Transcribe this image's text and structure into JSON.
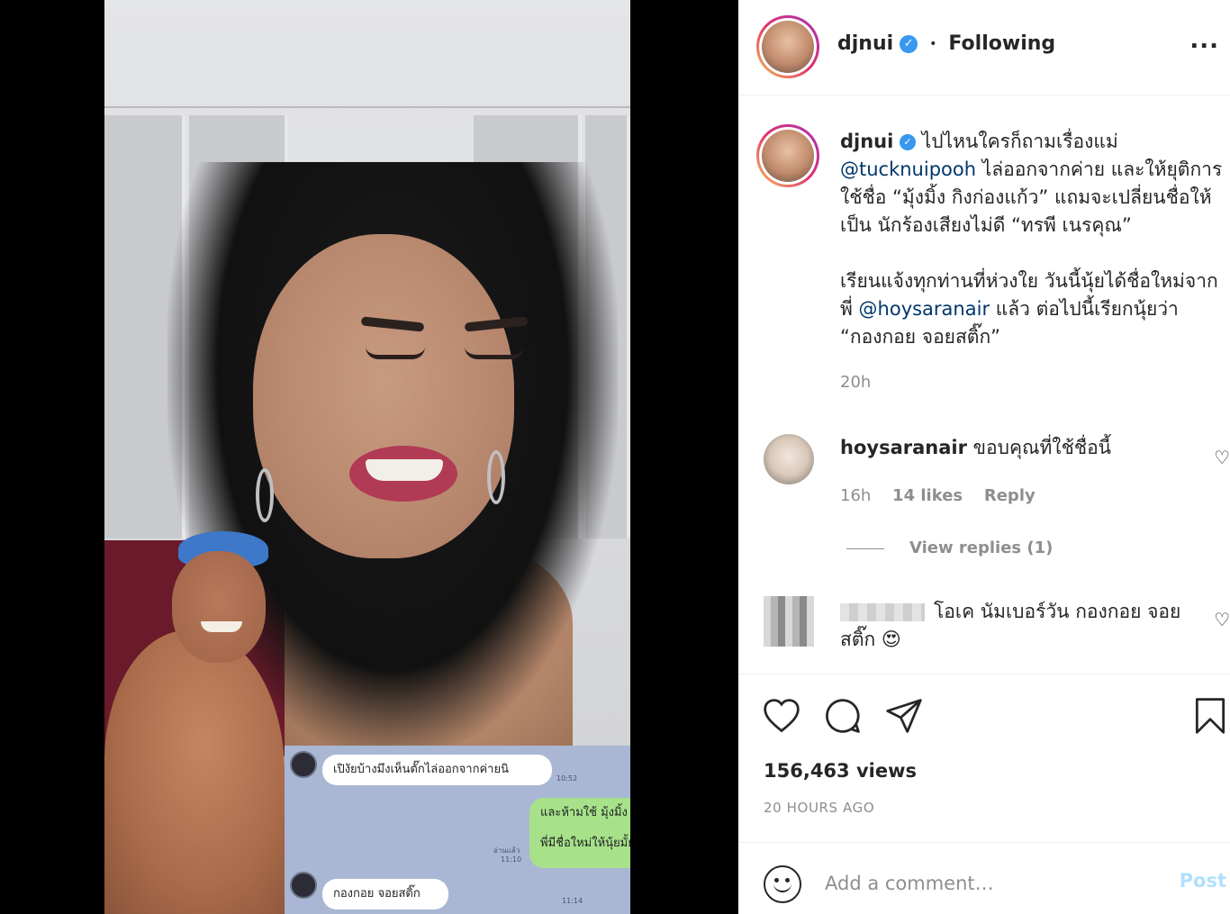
{
  "colors": {
    "link": "#00376b",
    "verified": "#3897f0",
    "muted": "#8e8e8e",
    "post_disabled": "#b2dffc"
  },
  "header": {
    "username": "djnui",
    "verified_icon": "verified-badge-icon",
    "dot": "•",
    "follow_status": "Following",
    "more": "..."
  },
  "caption": {
    "username": "djnui",
    "line1": "ไปไหนใครก็ถามเรื่องแม่",
    "mention1": "@tucknuipooh",
    "line2": " ไล่ออกจากค่าย และให้ยุติการใช้ชื่อ “มุ้งมิ้ง กิงก่องแก้ว” แถมจะเปลี่ยนชื่อให้เป็น นักร้องเสียงไม่ดี “ทรพี เนรคุณ”",
    "line3": "เรียนแจ้งทุกท่านที่ห่วงใย วันนี้นุ้ยได้ชื่อใหม่จากพี่ ",
    "mention2": "@hoysaranair",
    "line4": " แล้ว ต่อไปนี้เรียกนุ้ยว่า “กองกอย จอยสติ๊ก”",
    "time": "20h"
  },
  "comments": [
    {
      "username": "hoysaranair",
      "text": "ขอบคุณที่ใช้ชื่อนี้",
      "time": "16h",
      "likes": "14 likes",
      "reply": "Reply",
      "view_replies": "View replies (1)"
    },
    {
      "username": "",
      "text": "โอเค นัมเบอร์วัน กองกอย จอยสติ๊ก",
      "emoji": "😍"
    }
  ],
  "video_chat": {
    "msg1": "เปิงัยบ้างมึงเห็นตั๊กไล่ออกจากค่ายนิ",
    "time1": "10:52",
    "msg2": "และห้ามใช้ มุ้งมิ้ง กิงก่องแก้ว",
    "msg3": "พี่มีชื่อใหม่ให้นุ้ยมั้ยพี่",
    "read": "อ่านแล้ว",
    "time2": "11:10",
    "msg4": "กองกอย  จอยสติ๊ก",
    "time3": "11:14"
  },
  "stats": {
    "views": "156,463 views",
    "ago": "20 HOURS AGO"
  },
  "comment_box": {
    "placeholder": "Add a comment…",
    "post": "Post"
  },
  "icons": [
    "heart-icon",
    "comment-icon",
    "share-icon",
    "bookmark-icon",
    "emoji-icon",
    "more-icon"
  ]
}
